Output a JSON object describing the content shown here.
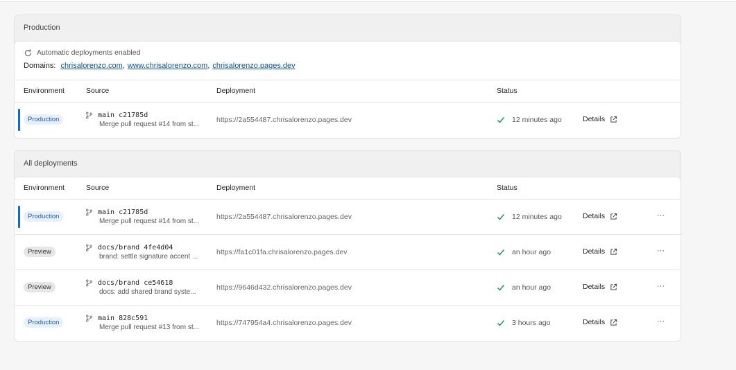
{
  "production": {
    "title": "Production",
    "auto_deploy": "Automatic deployments enabled",
    "domains_label": "Domains:",
    "domains": [
      "chrisalorenzo.com",
      "www.chrisalorenzo.com",
      "chrisalorenzo.pages.dev"
    ],
    "columns": [
      "Environment",
      "Source",
      "Deployment",
      "Status"
    ],
    "rows": [
      {
        "env": "Production",
        "env_type": "production",
        "active": true,
        "branch_commit": "main c21785d",
        "message": "Merge pull request #14 from st...",
        "url": "https://2a554487.chrisalorenzo.pages.dev",
        "status": "12 minutes ago",
        "details": "Details"
      }
    ]
  },
  "all": {
    "title": "All deployments",
    "columns": [
      "Environment",
      "Source",
      "Deployment",
      "Status"
    ],
    "rows": [
      {
        "env": "Production",
        "env_type": "production",
        "active": true,
        "branch_commit": "main c21785d",
        "message": "Merge pull request #14 from st...",
        "url": "https://2a554487.chrisalorenzo.pages.dev",
        "status": "12 minutes ago",
        "details": "Details",
        "more": "···"
      },
      {
        "env": "Preview",
        "env_type": "preview",
        "active": false,
        "branch_commit": "docs/brand 4fe4d04",
        "message": "brand: settle signature accent ...",
        "url": "https://fa1c01fa.chrisalorenzo.pages.dev",
        "status": "an hour ago",
        "details": "Details",
        "more": "···"
      },
      {
        "env": "Preview",
        "env_type": "preview",
        "active": false,
        "branch_commit": "docs/brand ce54618",
        "message": "docs: add shared brand syste...",
        "url": "https://9646d432.chrisalorenzo.pages.dev",
        "status": "an hour ago",
        "details": "Details",
        "more": "···"
      },
      {
        "env": "Production",
        "env_type": "production",
        "active": false,
        "branch_commit": "main 828c591",
        "message": "Merge pull request #13 from st...",
        "url": "https://747954a4.chrisalorenzo.pages.dev",
        "status": "3 hours ago",
        "details": "Details",
        "more": "···"
      }
    ]
  },
  "colors": {
    "accent": "#1468d6",
    "link": "#0b53a5",
    "success": "#1a9a4a"
  },
  "icons": {
    "refresh": "refresh-icon",
    "branch": "git-branch-icon",
    "check": "check-icon",
    "external": "external-link-icon"
  }
}
